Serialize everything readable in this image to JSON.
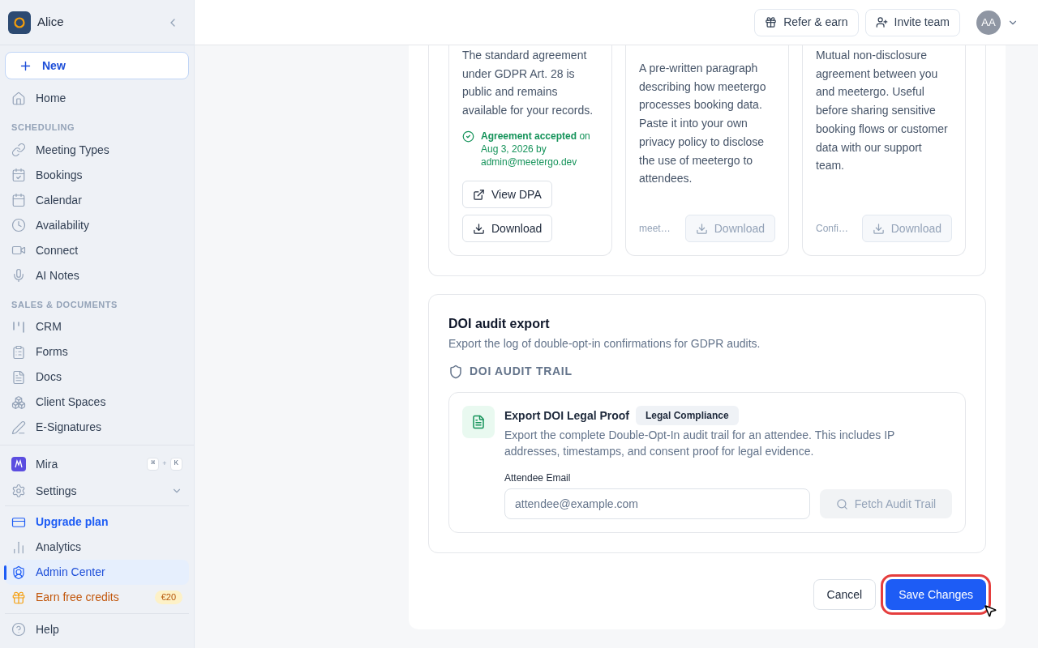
{
  "sidebar": {
    "workspace": "Alice",
    "new_button": "New",
    "items": [
      {
        "kind": "link",
        "label": "Home",
        "selected": false
      },
      {
        "kind": "section",
        "label": "SCHEDULING"
      },
      {
        "kind": "link",
        "label": "Meeting Types",
        "selected": false
      },
      {
        "kind": "link",
        "label": "Bookings",
        "selected": false
      },
      {
        "kind": "link",
        "label": "Calendar",
        "selected": false
      },
      {
        "kind": "link",
        "label": "Availability",
        "selected": false
      },
      {
        "kind": "link",
        "label": "Connect",
        "selected": false
      },
      {
        "kind": "link",
        "label": "AI Notes",
        "selected": false
      },
      {
        "kind": "section",
        "label": "SALES & DOCUMENTS"
      },
      {
        "kind": "link",
        "label": "CRM",
        "selected": false
      },
      {
        "kind": "link",
        "label": "Forms",
        "selected": false
      },
      {
        "kind": "link",
        "label": "Docs",
        "selected": false
      },
      {
        "kind": "link",
        "label": "Client Spaces",
        "selected": false
      },
      {
        "kind": "link",
        "label": "E-Signatures",
        "selected": false
      }
    ],
    "assistant": {
      "label": "Mira",
      "keys": [
        "⌘",
        "K"
      ],
      "joiner": "+"
    },
    "settings": {
      "label": "Settings",
      "expanded": false
    },
    "bottom_items": [
      {
        "kind": "upgrade",
        "label": "Upgrade plan",
        "selected": false
      },
      {
        "kind": "link",
        "label": "Analytics",
        "selected": false
      },
      {
        "kind": "link",
        "label": "Admin Center",
        "selected": true
      },
      {
        "kind": "promo",
        "label": "Earn free credits",
        "badge": "€20",
        "selected": false
      }
    ],
    "help": "Help"
  },
  "header": {
    "buttons": [
      "Refer & earn",
      "Invite team"
    ],
    "avatar": "AA"
  },
  "documents": [
    {
      "description": "The standard agreement under GDPR Art. 28 is public and remains available for your records.",
      "status": "**Agreement accepted** on Aug 3, 2026 by admin@meetergo.dev",
      "actions": [
        {
          "kind": "view",
          "label": "View DPA",
          "disabled": false
        },
        {
          "kind": "download",
          "label": "Download",
          "disabled": false
        }
      ]
    },
    {
      "description": "A pre-written paragraph describing how meetergo processes booking data. Paste it into your own privacy policy to disclose the use of meetergo to attendees.",
      "footer": "meet…",
      "actions": [
        {
          "kind": "download",
          "label": "Download",
          "disabled": true
        }
      ]
    },
    {
      "description": "Mutual non-disclosure agreement between you and meetergo. Useful before sharing sensitive booking flows or customer data with our support team.",
      "footer": "Confi…",
      "actions": [
        {
          "kind": "download",
          "label": "Download",
          "disabled": true
        }
      ]
    }
  ],
  "doi_export": {
    "title": "DOI audit export",
    "description": "Export the log of double-opt-in confirmations for GDPR audits.",
    "section_label": "DOI AUDIT TRAIL",
    "card": {
      "title": "Export DOI Legal Proof",
      "badge": "Legal Compliance",
      "description": "Export the complete Double-Opt-In audit trail for an attendee. This includes IP addresses, timestamps, and consent proof for legal evidence.",
      "field_label": "Attendee Email",
      "placeholder": "attendee@example.com",
      "button": {
        "label": "Fetch Audit Trail",
        "disabled": true
      }
    }
  },
  "footer": {
    "cancel": "Cancel",
    "save": {
      "label": "Save Changes",
      "highlighted": true
    }
  }
}
